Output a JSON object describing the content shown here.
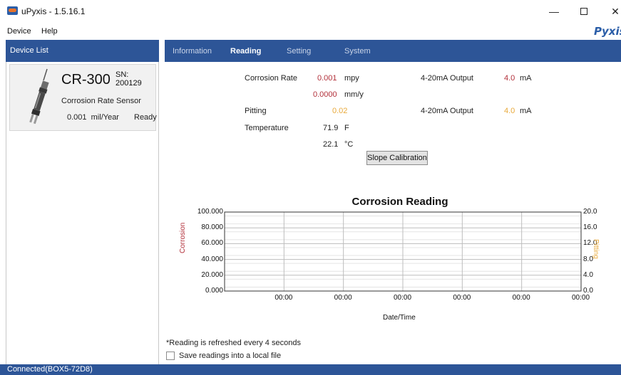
{
  "window": {
    "title": "uPyxis - 1.5.16.1",
    "minimize_glyph": "—",
    "close_glyph": "✕",
    "brand": "Pyxis"
  },
  "menu": {
    "device": "Device",
    "help": "Help"
  },
  "sidebar": {
    "header": "Device List",
    "device": {
      "model": "CR-300",
      "sn": "SN: 200129",
      "type": "Corrosion Rate Sensor",
      "reading": "0.001  mil/Year",
      "status": "Ready",
      "icon": "probe-sensor-icon"
    }
  },
  "tabs": [
    {
      "label": "Information"
    },
    {
      "label": "Reading"
    },
    {
      "label": "Setting"
    },
    {
      "label": "System"
    }
  ],
  "active_tab": "Reading",
  "readings": {
    "corrosion_rate_label": "Corrosion Rate",
    "corrosion_mpy_value": "0.001",
    "corrosion_mpy_unit": "mpy",
    "corrosion_mmy_value": "0.0000",
    "corrosion_mmy_unit": "mm/y",
    "pitting_label": "Pitting",
    "pitting_value": "0.02",
    "temperature_label": "Temperature",
    "temp_f_value": "71.9",
    "temp_f_unit": "F",
    "temp_c_value": "22.1",
    "temp_c_unit": "°C",
    "output1_label": "4-20mA Output",
    "output1_value": "4.0",
    "output1_unit": "mA",
    "output2_label": "4-20mA Output",
    "output2_value": "4.0",
    "output2_unit": "mA",
    "calibration_button": "Slope Calibration"
  },
  "colors": {
    "accent": "#2d5597",
    "corrosion": "#b2303a",
    "pitting": "#e8a93a"
  },
  "chart_data": {
    "type": "line",
    "title": "Corrosion Reading",
    "xlabel": "Date/Time",
    "ylabel": "Corrosion",
    "y2label": "Pitting",
    "x_ticks": [
      "00:00",
      "00:00",
      "00:00",
      "00:00",
      "00:00",
      "00:00"
    ],
    "y_ticks": [
      "0.000",
      "20.000",
      "40.000",
      "60.000",
      "80.000",
      "100.000"
    ],
    "y2_ticks": [
      "0.0",
      "4.0",
      "8.0",
      "12.0",
      "16.0",
      "20.0"
    ],
    "ylim": [
      0,
      100
    ],
    "y2lim": [
      0,
      20
    ],
    "grid": true,
    "series": []
  },
  "footer": {
    "refresh_note": "*Reading is refreshed every 4 seconds",
    "save_label": "Save readings into a local file",
    "save_checked": false
  },
  "status_bar": "Connected(BOX5-72D8)"
}
